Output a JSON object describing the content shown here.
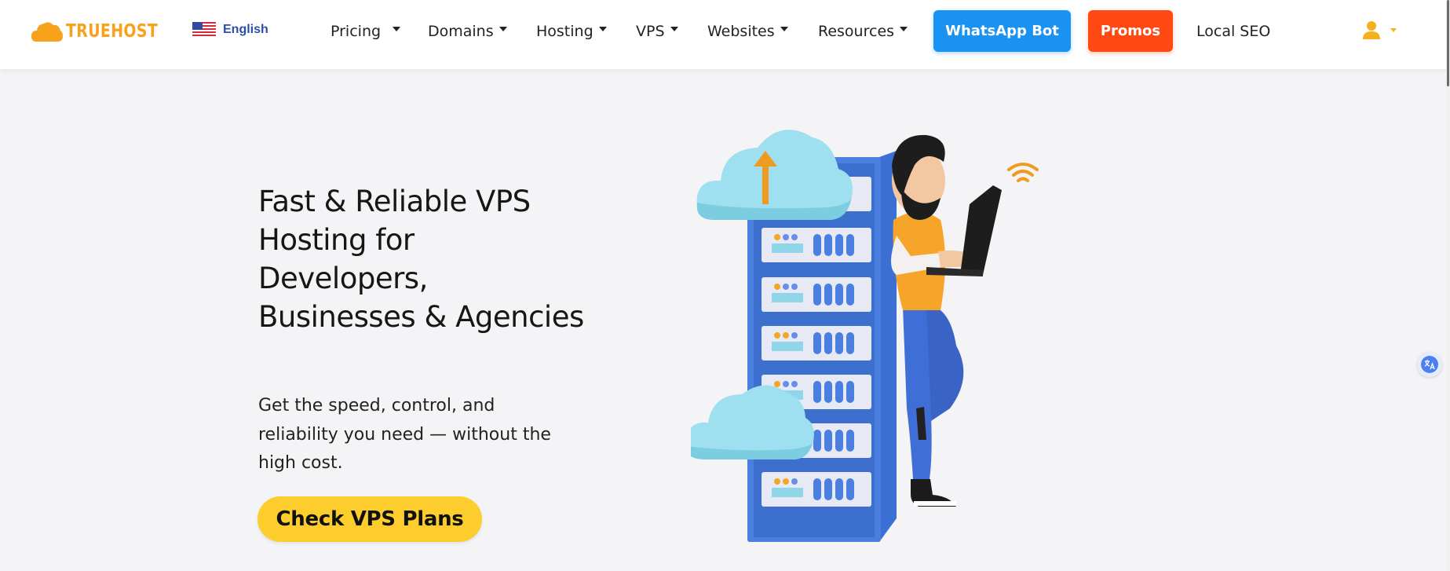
{
  "brand": {
    "logo_text": "TRUEHOST",
    "accent": "#f7a21b"
  },
  "language": {
    "label": "English",
    "flag_icon": "us-flag-icon"
  },
  "nav": {
    "items": [
      {
        "label": "Pricing"
      },
      {
        "label": "Domains"
      },
      {
        "label": "Hosting"
      },
      {
        "label": "VPS"
      },
      {
        "label": "Websites"
      },
      {
        "label": "Resources"
      }
    ],
    "whatsapp_label": "WhatsApp Bot",
    "whatsapp_color": "#1992f2",
    "promos_label": "Promos",
    "promos_color": "#fe4a12",
    "local_seo_label": "Local SEO",
    "user_icon": "user-icon"
  },
  "hero": {
    "title": "Fast & Reliable VPS Hosting for Developers, Businesses & Agencies",
    "subtitle": "Get the speed, control, and reliability you need — without the high cost.",
    "cta_label": "Check VPS Plans",
    "cta_color": "#fdcd2d"
  },
  "widgets": {
    "translate_icon": "translate-icon"
  }
}
